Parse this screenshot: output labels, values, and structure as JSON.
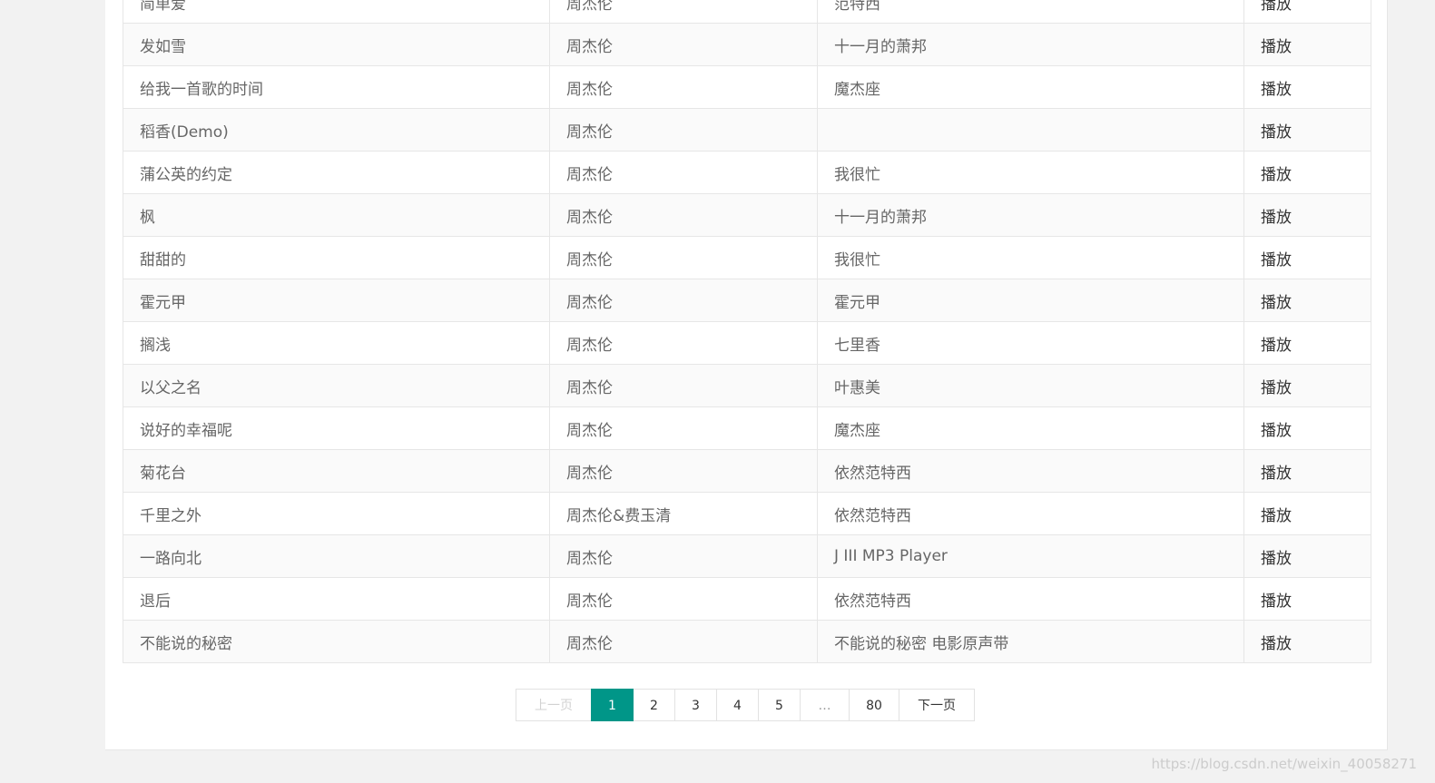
{
  "songs": [
    {
      "title": "简单爱",
      "artist": "周杰伦",
      "album": "范特西",
      "action": "播放"
    },
    {
      "title": "发如雪",
      "artist": "周杰伦",
      "album": "十一月的萧邦",
      "action": "播放"
    },
    {
      "title": "给我一首歌的时间",
      "artist": "周杰伦",
      "album": "魔杰座",
      "action": "播放"
    },
    {
      "title": "稻香(Demo)",
      "artist": "周杰伦",
      "album": "",
      "action": "播放"
    },
    {
      "title": "蒲公英的约定",
      "artist": "周杰伦",
      "album": "我很忙",
      "action": "播放"
    },
    {
      "title": "枫",
      "artist": "周杰伦",
      "album": "十一月的萧邦",
      "action": "播放"
    },
    {
      "title": "甜甜的",
      "artist": "周杰伦",
      "album": "我很忙",
      "action": "播放"
    },
    {
      "title": "霍元甲",
      "artist": "周杰伦",
      "album": "霍元甲",
      "action": "播放"
    },
    {
      "title": "搁浅",
      "artist": "周杰伦",
      "album": "七里香",
      "action": "播放"
    },
    {
      "title": "以父之名",
      "artist": "周杰伦",
      "album": "叶惠美",
      "action": "播放"
    },
    {
      "title": "说好的幸福呢",
      "artist": "周杰伦",
      "album": "魔杰座",
      "action": "播放"
    },
    {
      "title": "菊花台",
      "artist": "周杰伦",
      "album": "依然范特西",
      "action": "播放"
    },
    {
      "title": "千里之外",
      "artist": "周杰伦&费玉清",
      "album": "依然范特西",
      "action": "播放"
    },
    {
      "title": "一路向北",
      "artist": "周杰伦",
      "album": "J III MP3 Player",
      "action": "播放"
    },
    {
      "title": "退后",
      "artist": "周杰伦",
      "album": "依然范特西",
      "action": "播放"
    },
    {
      "title": "不能说的秘密",
      "artist": "周杰伦",
      "album": "不能说的秘密 电影原声带",
      "action": "播放"
    }
  ],
  "pagination": {
    "prev": "上一页",
    "pages": [
      "1",
      "2",
      "3",
      "4",
      "5"
    ],
    "current": "1",
    "ellipsis": "…",
    "last": "80",
    "next": "下一页"
  },
  "watermark": "https://blog.csdn.net/weixin_40058271"
}
